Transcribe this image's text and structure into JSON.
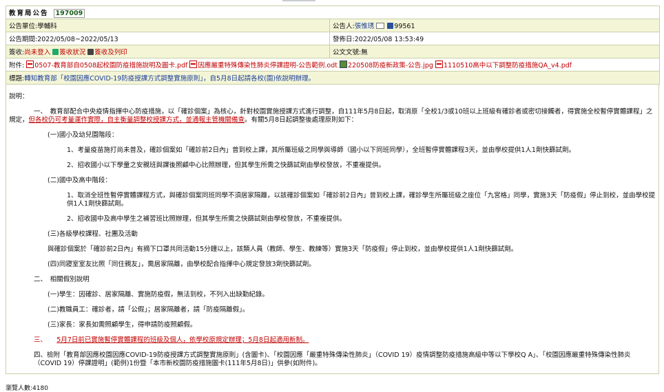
{
  "header": {
    "title": "教育局公告",
    "id": "197009"
  },
  "unit": {
    "label": "公告單位:",
    "value": "學輔科"
  },
  "poster": {
    "label": "公告人:",
    "name": "張惟琇",
    "phone": "99561"
  },
  "period": {
    "label": "公告期間:",
    "value": "2022/05/08~2022/05/13"
  },
  "published": {
    "label": "發佈日:",
    "value": "2022/05/08 13:53:49"
  },
  "sign": {
    "label": "簽收:",
    "status": "尚未登入",
    "link1": "簽收狀況",
    "link2": "簽收及列印"
  },
  "doc_no": {
    "label": "公文文號:",
    "value": "無"
  },
  "attachments": {
    "label": "附件:",
    "items": [
      "0507-教育部自0508起校園防疫措施說明及圖卡.pdf",
      "因應嚴重特殊傳染性肺炎停課證明-公告範例.odt",
      "220508防疫新政策-公告.jpg",
      "1110510高中以下調整防疫措施QA_v4.pdf"
    ]
  },
  "subject": {
    "label": "標題:",
    "value": "轉知教育部「校園因應COVID-19防疫授課方式調整實施原則」，自5月8日起請各校(園)依說明辦理。"
  },
  "content": {
    "intro": "說明：",
    "p1a": "一、　教育部配合中央疫情指揮中心防疫措施，以「確診個案」為核心，針對校園實施授課方式進行調整，自111年5月8日起，取消原「全校1/3或10班以上班級有確診者或密切接觸者，得實施全校暫停實體課程」之",
    "p1b_pre": "規定，",
    "p1b_red": "但各校仍可考量運作實際，自主衡量調整校授課方式，並通報主管機關備查",
    "p1b_post": "。有關5月8日起調整後處理原則如下：",
    "s1": "(一)國小及幼兒園階段：",
    "s1_1": "1、考量疫苗施打尚未普及，確診個案如「確診前2日內」曾到校上課，其所屬班級之同學與導師（國小以下同班同學），全班暫停實體課程3天，並由學校提供1人1劑快篩試劑。",
    "s1_2": "2、招收國小以下學童之安親班與課後照顧中心比照辦理，但其學生所需之快篩試劑由學校發放，不重複提供。",
    "s2": "(二)國中及高中階段：",
    "s2_1a": "1、取消全班性暫停實體課程方式，與確診個案同班同學不須居家隔離，以該確診個案如「確診前2日內」曾到校上課，確診學生所屬班級之座位「九宮格」同學，實施3天「防疫假」停止到校，並由學校提",
    "s2_1b": "供1人1劑快篩試劑。",
    "s2_2": "2、招收國中及高中學生之補習班比照辦理，但其學生所需之快篩試劑由學校發放，不重複提供。",
    "s3": "(三)各級學校課程、社團及活動",
    "s3_body": "與確診個案於「確診前2日內」有摘下口罩共同活動15分鐘以上，該類人員（教師、學生、教練等）實施3天「防疫假」停止到校，並由學校提供1人1劑快篩試劑。",
    "s4": "(四)同寢室室友比照「同住親友」，需居家隔離，由學校配合指揮中心規定發放3劑快篩試劑。",
    "p2": "二、　相關假別說明",
    "p2_1": "(一)學生：因確診、居家隔離、實施防疫假，無法到校，不列入出缺勤紀錄。",
    "p2_2": "(二)教職員工：確診者，請「公假」；居家隔離者，請「防疫隔離假」。",
    "p2_3": "(三)家長：家長如需照顧學生，得申請防疫照顧假。",
    "p3_num": "三、",
    "p3_red": "5月7日前已實施暫停實體課程的班級及個人，依學校原規定辦理；5月8日起適用新制。",
    "p4a": "四、檢附「教育部因應校園因應COVID-19防疫授課方式調整實施原則」(含圖卡)、「校園因應「嚴重特殊傳染性肺炎」（COVID 19）疫情調整防疫措施高級中等以下學校Q A」、「校園因應嚴重特殊傳染性肺炎",
    "p4b": "（COVID 19）停課證明」(範例)1份暨「本市新校園防疫措施圖卡(111年5月8日)」供參(如附件)。"
  },
  "views": "瀏覽人數:4180",
  "colors": {
    "accent_red": "#c00000",
    "row_yellow": "#f3f5d6",
    "border": "#c9cfa6"
  }
}
